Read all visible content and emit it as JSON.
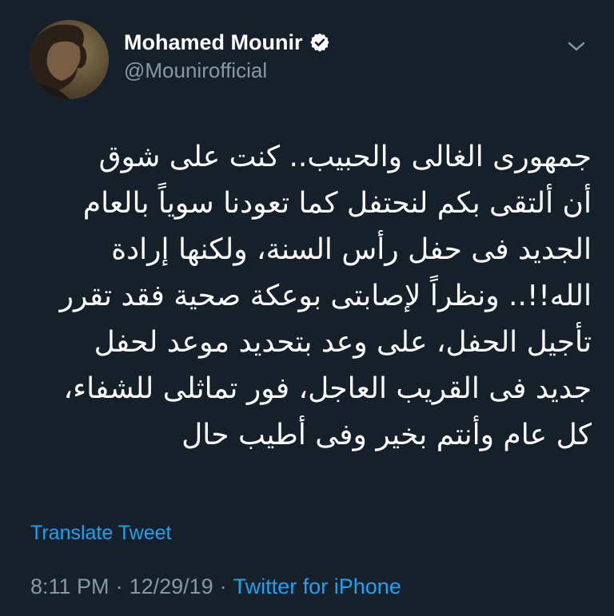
{
  "user": {
    "display_name": "Mohamed Mounir",
    "handle": "@Mounirofficial",
    "verified": true
  },
  "icons": {
    "verified": "verified-badge-icon",
    "caret": "chevron-down-icon"
  },
  "tweet": {
    "text": "جمهورى الغالى والحبيب.. كنت على شوق\nأن ألتقى بكم لنحتفل كما تعودنا سوياً بالعام\nالجديد فى حفل رأس السنة، ولكنها إرادة\nالله!!.. ونظراً لإصابتى بوعكة صحية فقد تقرر\nتأجيل الحفل، على وعد بتحديد موعد لحفل\nجديد فى القريب العاجل، فور تماثلى للشفاء،\nكل عام وأنتم بخير وفى أطيب حال",
    "translate_label": "Translate Tweet"
  },
  "meta": {
    "time": "8:11 PM",
    "date": "12/29/19",
    "separator": "·",
    "source": "Twitter for iPhone"
  },
  "colors": {
    "background": "#15202b",
    "primary_text": "#ffffff",
    "secondary_text": "#8899a6",
    "accent": "#1da1f2"
  }
}
